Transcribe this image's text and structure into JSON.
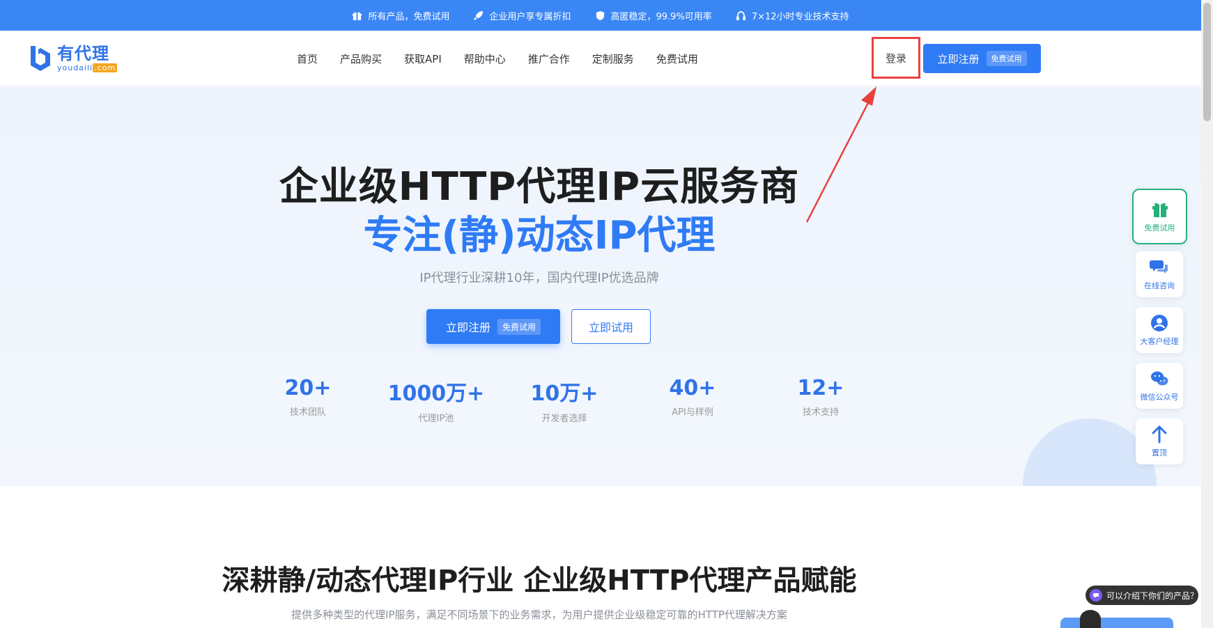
{
  "promo": {
    "items": [
      {
        "icon": "gift-icon",
        "text": "所有产品，免费试用"
      },
      {
        "icon": "rocket-icon",
        "text": "企业用户享专属折扣"
      },
      {
        "icon": "shield-icon",
        "text": "高匿稳定，99.9%可用率"
      },
      {
        "icon": "headset-icon",
        "text": "7×12小时专业技术支持"
      }
    ]
  },
  "header": {
    "logo_cn": "有代理",
    "logo_en": "youdaili",
    "logo_com": ".com",
    "nav": [
      "首页",
      "产品购买",
      "获取API",
      "帮助中心",
      "推广合作",
      "定制服务",
      "免费试用"
    ],
    "login_label": "登录",
    "register_label": "立即注册",
    "register_badge": "免费试用"
  },
  "hero": {
    "title": "企业级HTTP代理IP云服务商",
    "subtitle": "专注(静)动态IP代理",
    "description": "IP代理行业深耕10年，国内代理IP优选品牌",
    "primary_button": "立即注册",
    "primary_badge": "免费试用",
    "secondary_button": "立即试用",
    "stats": [
      {
        "num": "20+",
        "label": "技术团队"
      },
      {
        "num": "1000万+",
        "label": "代理IP池"
      },
      {
        "num": "10万+",
        "label": "开发者选择"
      },
      {
        "num": "40+",
        "label": "API与样例"
      },
      {
        "num": "12+",
        "label": "技术支持"
      }
    ]
  },
  "section2": {
    "title": "深耕静/动态代理IP行业 企业级HTTP代理产品赋能",
    "description": "提供多种类型的代理IP服务，满足不同场景下的业务需求，为用户提供企业级稳定可靠的HTTP代理解决方案"
  },
  "float_bar": {
    "trial": "免费试用",
    "consult": "在线咨询",
    "manager": "大客户经理",
    "wechat": "微信公众号",
    "top": "置顶"
  },
  "chat": {
    "bubble": "可以介绍下你们的产品？"
  },
  "colors": {
    "primary": "#2f7bf5",
    "promo_bar": "#3a86f5",
    "highlight_box": "#e8423f",
    "trial_green": "#25b07a"
  }
}
